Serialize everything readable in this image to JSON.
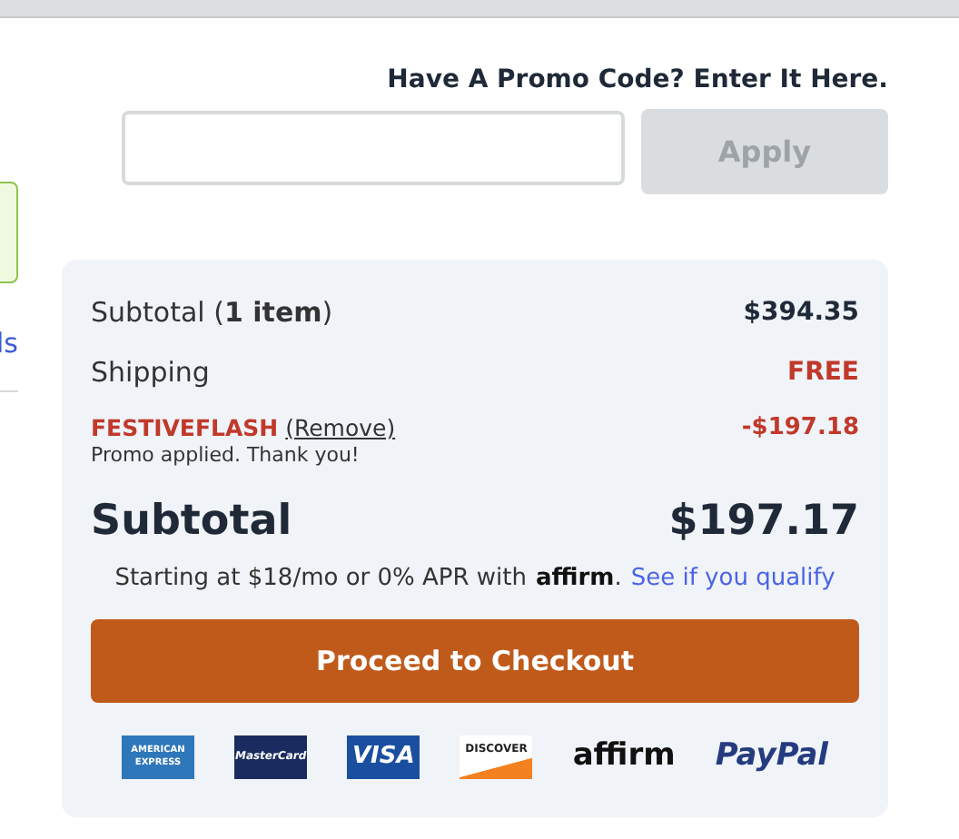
{
  "side": {
    "link_fragment": "ls"
  },
  "promo": {
    "heading": "Have A Promo Code? Enter It Here.",
    "button": "Apply",
    "button_disabled": true
  },
  "summary": {
    "rows": [
      {
        "label": "Subtotal (**1 item**)",
        "value": "$394.35",
        "kind": "plain"
      },
      {
        "label": "Shipping",
        "value": "FREE",
        "kind": "highlight"
      }
    ],
    "promo_code": {
      "code": "FESTIVEFLASH",
      "remove": "(Remove)",
      "note": "Promo applied. Thank you!",
      "value": "-$197.18"
    },
    "total": {
      "label": "Subtotal",
      "value": "$197.17"
    },
    "financing": {
      "text": "Starting at $18/mo or 0% APR with",
      "brand": "affirm",
      "after_brand": ".",
      "link": "See if you qualify"
    },
    "checkout": "Proceed to Checkout",
    "payment_logos": [
      {
        "kind": "amex",
        "label": "AMERICAN EXPRESS"
      },
      {
        "kind": "mastercard",
        "label": "MasterCard"
      },
      {
        "kind": "visa",
        "label": "VISA"
      },
      {
        "kind": "discover",
        "label": "DISCOVER"
      },
      {
        "kind": "affirm",
        "label": "affirm"
      },
      {
        "kind": "paypal",
        "label": "PayPal"
      }
    ]
  }
}
